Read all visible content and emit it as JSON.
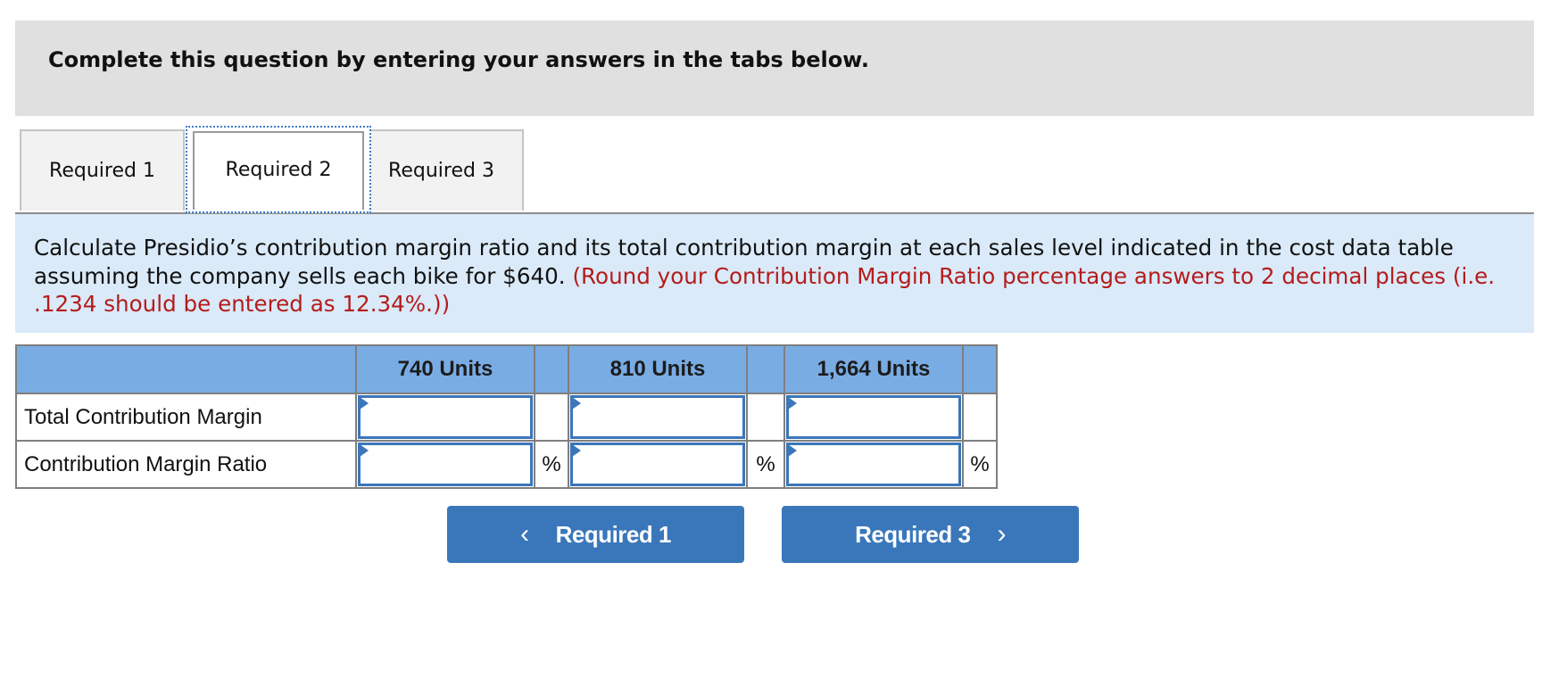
{
  "header": {
    "instruction": "Complete this question by entering your answers in the tabs below."
  },
  "tabs": [
    {
      "label": "Required 1",
      "active": false
    },
    {
      "label": "Required 2",
      "active": true
    },
    {
      "label": "Required 3",
      "active": false
    }
  ],
  "instructions": {
    "main_text": "Calculate Presidio’s contribution margin ratio and its total contribution margin at each sales level indicated in the cost data table assuming the company sells each bike for $640.",
    "note_text": "(Round your Contribution Margin Ratio percentage answers to 2 decimal places (i.e. .1234 should be entered as 12.34%.))"
  },
  "table": {
    "columns": [
      "740 Units",
      "810 Units",
      "1,664 Units"
    ],
    "rows": [
      {
        "label": "Total Contribution Margin",
        "values": [
          "",
          "",
          ""
        ],
        "suffix": [
          "",
          "",
          ""
        ]
      },
      {
        "label": "Contribution Margin Ratio",
        "values": [
          "",
          "",
          ""
        ],
        "suffix": [
          "%",
          "%",
          "%"
        ]
      }
    ]
  },
  "navigation": {
    "prev_label": "Required 1",
    "next_label": "Required 3",
    "prev_icon": "chevron-left-icon",
    "next_icon": "chevron-right-icon"
  },
  "colors": {
    "header_bg": "#e0e0e0",
    "instruction_bg": "#daeaf8",
    "note_red": "#b41c1c",
    "table_header_bg": "#7aace4",
    "input_border": "#3b76b9",
    "button_bg": "#3a77ba"
  }
}
